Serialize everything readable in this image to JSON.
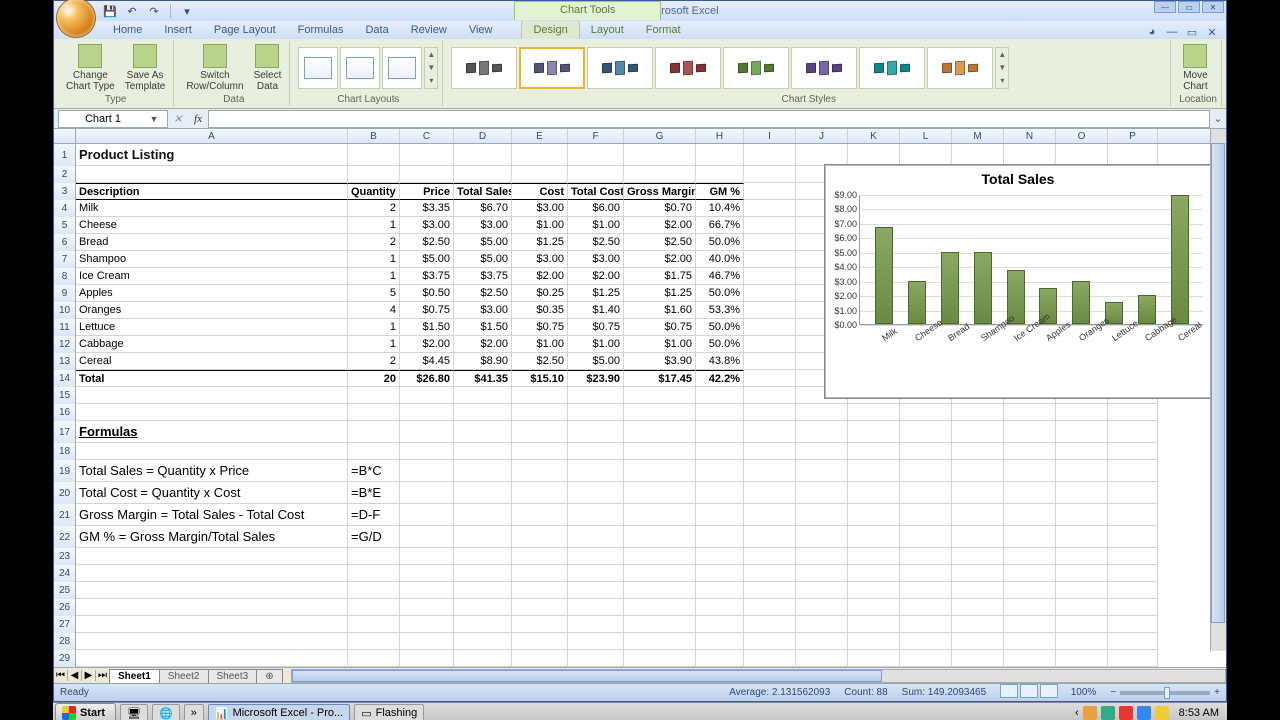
{
  "window": {
    "title": "Product Listing - Microsoft Excel",
    "chart_tools_label": "Chart Tools"
  },
  "ribbon_tabs": [
    "Home",
    "Insert",
    "Page Layout",
    "Formulas",
    "Data",
    "Review",
    "View"
  ],
  "chart_tabs": [
    "Design",
    "Layout",
    "Format"
  ],
  "ribbon_groups": {
    "type": "Type",
    "data": "Data",
    "chart_layouts": "Chart Layouts",
    "chart_styles": "Chart Styles",
    "location": "Location",
    "change_chart_type": "Change\nChart Type",
    "save_as_template": "Save As\nTemplate",
    "switch_rc": "Switch\nRow/Column",
    "select_data": "Select\nData",
    "move_chart": "Move\nChart"
  },
  "namebox": "Chart 1",
  "formula": "",
  "columns": [
    "A",
    "B",
    "C",
    "D",
    "E",
    "F",
    "G",
    "H",
    "I",
    "J",
    "K",
    "L",
    "M",
    "N",
    "O",
    "P"
  ],
  "sheet": {
    "title": "Product Listing",
    "headers": [
      "Description",
      "Quantity",
      "Price",
      "Total Sales",
      "Cost",
      "Total Cost",
      "Gross Margin",
      "GM %"
    ],
    "rows": [
      {
        "desc": "Milk",
        "qty": 2,
        "price": "$3.35",
        "ts": "$6.70",
        "cost": "$3.00",
        "tc": "$6.00",
        "gm": "$0.70",
        "gmp": "10.4%"
      },
      {
        "desc": "Cheese",
        "qty": 1,
        "price": "$3.00",
        "ts": "$3.00",
        "cost": "$1.00",
        "tc": "$1.00",
        "gm": "$2.00",
        "gmp": "66.7%"
      },
      {
        "desc": "Bread",
        "qty": 2,
        "price": "$2.50",
        "ts": "$5.00",
        "cost": "$1.25",
        "tc": "$2.50",
        "gm": "$2.50",
        "gmp": "50.0%"
      },
      {
        "desc": "Shampoo",
        "qty": 1,
        "price": "$5.00",
        "ts": "$5.00",
        "cost": "$3.00",
        "tc": "$3.00",
        "gm": "$2.00",
        "gmp": "40.0%"
      },
      {
        "desc": "Ice Cream",
        "qty": 1,
        "price": "$3.75",
        "ts": "$3.75",
        "cost": "$2.00",
        "tc": "$2.00",
        "gm": "$1.75",
        "gmp": "46.7%"
      },
      {
        "desc": "Apples",
        "qty": 5,
        "price": "$0.50",
        "ts": "$2.50",
        "cost": "$0.25",
        "tc": "$1.25",
        "gm": "$1.25",
        "gmp": "50.0%"
      },
      {
        "desc": "Oranges",
        "qty": 4,
        "price": "$0.75",
        "ts": "$3.00",
        "cost": "$0.35",
        "tc": "$1.40",
        "gm": "$1.60",
        "gmp": "53.3%"
      },
      {
        "desc": "Lettuce",
        "qty": 1,
        "price": "$1.50",
        "ts": "$1.50",
        "cost": "$0.75",
        "tc": "$0.75",
        "gm": "$0.75",
        "gmp": "50.0%"
      },
      {
        "desc": "Cabbage",
        "qty": 1,
        "price": "$2.00",
        "ts": "$2.00",
        "cost": "$1.00",
        "tc": "$1.00",
        "gm": "$1.00",
        "gmp": "50.0%"
      },
      {
        "desc": "Cereal",
        "qty": 2,
        "price": "$4.45",
        "ts": "$8.90",
        "cost": "$2.50",
        "tc": "$5.00",
        "gm": "$3.90",
        "gmp": "43.8%"
      }
    ],
    "total": {
      "desc": "Total",
      "qty": 20,
      "price": "$26.80",
      "ts": "$41.35",
      "cost": "$15.10",
      "tc": "$23.90",
      "gm": "$17.45",
      "gmp": "42.2%"
    },
    "formulas_heading": "Formulas",
    "formula_rows": [
      {
        "label": "Total Sales = Quantity x Price",
        "f": "=B*C"
      },
      {
        "label": "Total Cost = Quantity x Cost",
        "f": "=B*E"
      },
      {
        "label": "Gross Margin = Total Sales - Total Cost",
        "f": "=D-F"
      },
      {
        "label": "GM % = Gross Margin/Total Sales",
        "f": "=G/D"
      }
    ]
  },
  "chart_data": {
    "type": "bar",
    "title": "Total Sales",
    "categories": [
      "Milk",
      "Cheese",
      "Bread",
      "Shampoo",
      "Ice Cream",
      "Apples",
      "Oranges",
      "Lettuce",
      "Cabbage",
      "Cereal"
    ],
    "values": [
      6.7,
      3.0,
      5.0,
      5.0,
      3.75,
      2.5,
      3.0,
      1.5,
      2.0,
      8.9
    ],
    "ylim": [
      0,
      9
    ],
    "yticks": [
      "$0.00",
      "$1.00",
      "$2.00",
      "$3.00",
      "$4.00",
      "$5.00",
      "$6.00",
      "$7.00",
      "$8.00",
      "$9.00"
    ],
    "xlabel": "",
    "ylabel": ""
  },
  "style_colors": [
    [
      "#555",
      "#777"
    ],
    [
      "#557",
      "#88a"
    ],
    [
      "#357",
      "#58a"
    ],
    [
      "#833",
      "#a55"
    ],
    [
      "#573",
      "#7a5"
    ],
    [
      "#548",
      "#76a"
    ],
    [
      "#188",
      "#3aa"
    ],
    [
      "#b73",
      "#d95"
    ]
  ],
  "sheet_tabs": [
    "Sheet1",
    "Sheet2",
    "Sheet3"
  ],
  "statusbar": {
    "ready": "Ready",
    "average": "Average: 2.131562093",
    "count": "Count: 88",
    "sum": "Sum: 149.2093465",
    "zoom": "100%"
  },
  "taskbar": {
    "start": "Start",
    "app1": "Microsoft Excel - Pro...",
    "app2": "Flashing",
    "clock": "8:53 AM"
  }
}
